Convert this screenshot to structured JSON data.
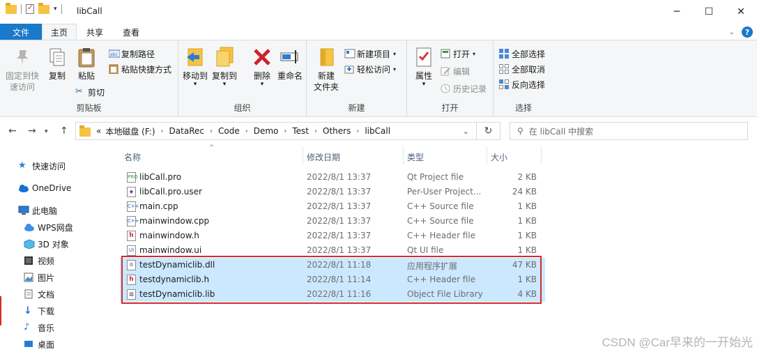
{
  "window": {
    "title": "libCall",
    "controls": [
      "─",
      "☐",
      "✕"
    ]
  },
  "ribbon_tabs": [
    "文件",
    "主页",
    "共享",
    "查看"
  ],
  "ribbon": {
    "clipboard": {
      "label": "剪贴板",
      "pin": [
        "固定到快",
        "速访问"
      ],
      "copy": "复制",
      "paste": "粘贴",
      "copy_path": "复制路径",
      "paste_shortcut": "粘贴快捷方式",
      "cut": "剪切"
    },
    "organize": {
      "label": "组织",
      "move_to": "移动到",
      "copy_to": "复制到",
      "delete": "删除",
      "rename": "重命名"
    },
    "new": {
      "label": "新建",
      "new_folder": [
        "新建",
        "文件夹"
      ],
      "new_item": "新建项目",
      "easy_access": "轻松访问"
    },
    "open": {
      "label": "打开",
      "properties": "属性",
      "open": "打开",
      "edit": "编辑",
      "history": "历史记录"
    },
    "select": {
      "label": "选择",
      "select_all": "全部选择",
      "select_none": "全部取消",
      "invert": "反向选择"
    }
  },
  "address": {
    "prefix": "«",
    "crumbs": [
      "本地磁盘 (F:)",
      "DataRec",
      "Code",
      "Demo",
      "Test",
      "Others",
      "libCall"
    ],
    "search_placeholder": "在 libCall 中搜索"
  },
  "nav_pane": [
    {
      "label": "快速访问",
      "icon": "star-icon"
    },
    {
      "label": "OneDrive",
      "icon": "cloud-icon"
    },
    {
      "label": "此电脑",
      "icon": "pc-icon"
    },
    {
      "label": "WPS网盘",
      "icon": "wps-cloud-icon"
    },
    {
      "label": "3D 对象",
      "icon": "cube-icon"
    },
    {
      "label": "视频",
      "icon": "video-icon"
    },
    {
      "label": "图片",
      "icon": "picture-icon"
    },
    {
      "label": "文档",
      "icon": "document-icon"
    },
    {
      "label": "下载",
      "icon": "download-icon"
    },
    {
      "label": "音乐",
      "icon": "music-icon"
    },
    {
      "label": "桌面",
      "icon": "desktop-icon"
    }
  ],
  "columns": {
    "name": "名称",
    "date": "修改日期",
    "type": "类型",
    "size": "大小"
  },
  "files": [
    {
      "name": "libCall.pro",
      "date": "2022/8/1 13:37",
      "type": "Qt Project file",
      "size": "2 KB",
      "icon": "pro",
      "selected": false
    },
    {
      "name": "libCall.pro.user",
      "date": "2022/8/1 13:37",
      "type": "Per-User Project...",
      "size": "24 KB",
      "icon": "user",
      "selected": false
    },
    {
      "name": "main.cpp",
      "date": "2022/8/1 13:37",
      "type": "C++ Source file",
      "size": "1 KB",
      "icon": "cpp",
      "selected": false
    },
    {
      "name": "mainwindow.cpp",
      "date": "2022/8/1 13:37",
      "type": "C++ Source file",
      "size": "1 KB",
      "icon": "cpp",
      "selected": false
    },
    {
      "name": "mainwindow.h",
      "date": "2022/8/1 13:37",
      "type": "C++ Header file",
      "size": "1 KB",
      "icon": "h",
      "selected": false
    },
    {
      "name": "mainwindow.ui",
      "date": "2022/8/1 13:37",
      "type": "Qt UI file",
      "size": "1 KB",
      "icon": "ui",
      "selected": false
    },
    {
      "name": "testDynamiclib.dll",
      "date": "2022/8/1 11:18",
      "type": "应用程序扩展",
      "size": "47 KB",
      "icon": "dll",
      "selected": true
    },
    {
      "name": "testdynamiclib.h",
      "date": "2022/8/1 11:14",
      "type": "C++ Header file",
      "size": "1 KB",
      "icon": "h",
      "selected": true
    },
    {
      "name": "testDynamiclib.lib",
      "date": "2022/8/1 11:16",
      "type": "Object File Library",
      "size": "4 KB",
      "icon": "lib",
      "selected": true
    }
  ],
  "watermark": "CSDN @Car早来的一开始光"
}
